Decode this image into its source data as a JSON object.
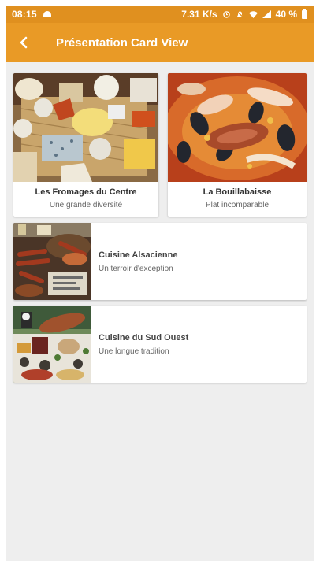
{
  "status_bar": {
    "time": "08:15",
    "network_speed": "7.31 K/s",
    "battery": "40 %",
    "icons": [
      "notification-icon",
      "alarm-icon",
      "mute-icon",
      "wifi-icon",
      "signal-icon",
      "battery-icon"
    ]
  },
  "app_bar": {
    "title": "Présentation Card View",
    "back_icon": "arrow-back-icon",
    "color": "#e99a26"
  },
  "cards": [
    {
      "title": "Les Fromages du Centre",
      "subtitle": "Une grande diversité",
      "image": "cheese-platter"
    },
    {
      "title": "La Bouillabaisse",
      "subtitle": "Plat incomparable",
      "image": "seafood-stew"
    },
    {
      "title": "Cuisine Alsacienne",
      "subtitle": "Un terroir d'exception",
      "image": "sausages-platter"
    },
    {
      "title": "Cuisine du Sud Ouest",
      "subtitle": "Une longue tradition",
      "image": "southwest-table"
    }
  ]
}
